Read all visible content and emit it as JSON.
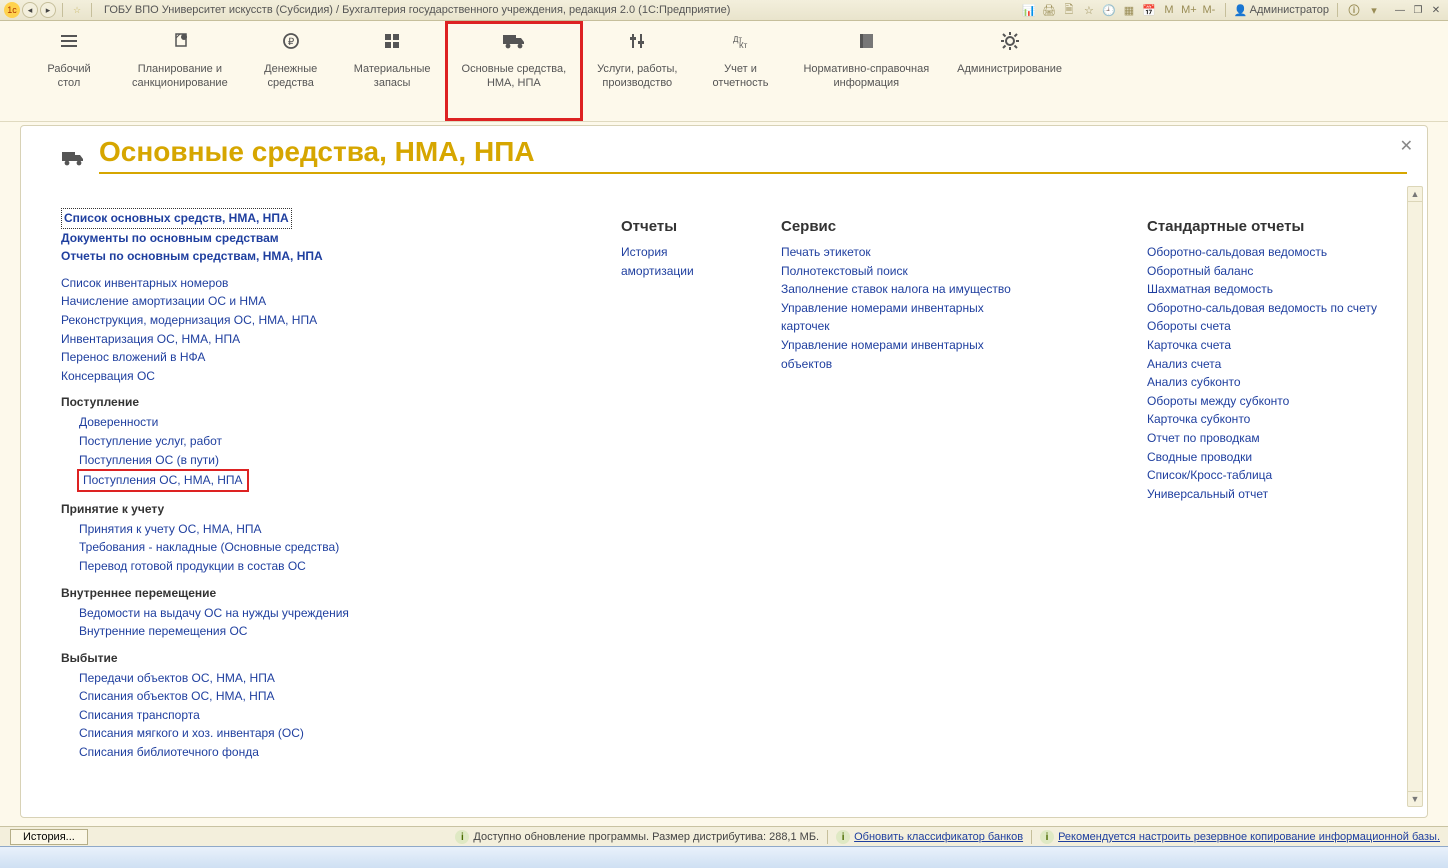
{
  "titlebar": {
    "title": "ГОБУ ВПО Университет искусств (Субсидия) / Бухгалтерия государственного учреждения, редакция 2.0  (1С:Предприятие)",
    "user": "Администратор",
    "m": "M",
    "mp": "M+",
    "mm": "M-"
  },
  "ribbon": [
    {
      "id": "desktop",
      "label": "Рабочий\nстол"
    },
    {
      "id": "planning",
      "label": "Планирование и\nсанкционирование"
    },
    {
      "id": "cash",
      "label": "Денежные\nсредства"
    },
    {
      "id": "stock",
      "label": "Материальные\nзапасы"
    },
    {
      "id": "fixed",
      "label": "Основные средства,\nНМА, НПА",
      "active": true
    },
    {
      "id": "services",
      "label": "Услуги, работы,\nпроизводство"
    },
    {
      "id": "accounting",
      "label": "Учет и\nотчетность"
    },
    {
      "id": "refs",
      "label": "Нормативно-справочная\nинформация"
    },
    {
      "id": "admin",
      "label": "Администрирование"
    }
  ],
  "page": {
    "title": "Основные средства, НМА, НПА"
  },
  "col1": {
    "top": [
      {
        "t": "Список основных средств, НМА, НПА",
        "bold": true,
        "sel": true
      },
      {
        "t": "Документы по основным средствам",
        "bold": true
      },
      {
        "t": "Отчеты по основным средствам, НМА, НПА",
        "bold": true
      }
    ],
    "ops": [
      "Список инвентарных номеров",
      "Начисление амортизации ОС и НМА",
      "Реконструкция, модернизация ОС, НМА, НПА",
      "Инвентаризация ОС, НМА, НПА",
      "Перенос вложений в НФА",
      "Консервация ОС"
    ],
    "g_post": "Поступление",
    "post": [
      "Доверенности",
      "Поступление услуг, работ",
      "Поступления ОС (в пути)"
    ],
    "post_hl": "Поступления ОС, НМА, НПА",
    "g_accept": "Принятие к учету",
    "accept": [
      "Принятия к учету ОС, НМА, НПА",
      "Требования - накладные (Основные средства)",
      "Перевод готовой продукции в состав ОС"
    ],
    "g_move": "Внутреннее перемещение",
    "move": [
      "Ведомости на выдачу ОС на нужды учреждения",
      "Внутренние перемещения ОС"
    ],
    "g_dispose": "Выбытие",
    "dispose": [
      "Передачи объектов ОС, НМА, НПА",
      "Списания объектов ОС, НМА, НПА",
      "Списания транспорта",
      "Списания мягкого и хоз. инвентаря (ОС)",
      "Списания библиотечного фонда"
    ]
  },
  "col2": {
    "h": "Отчеты",
    "items": [
      "История",
      "амортизации"
    ]
  },
  "col3": {
    "h": "Сервис",
    "items": [
      "Печать этикеток",
      "Полнотекстовый поиск",
      "Заполнение ставок налога на имущество",
      "Управление номерами инвентарных карточек",
      "Управление номерами инвентарных объектов"
    ]
  },
  "col4": {
    "h": "Стандартные отчеты",
    "items": [
      "Оборотно-сальдовая ведомость",
      "Оборотный баланс",
      "Шахматная ведомость",
      "Оборотно-сальдовая ведомость по счету",
      "Обороты счета",
      "Карточка счета",
      "Анализ счета",
      "Анализ субконто",
      "Обороты между субконто",
      "Карточка субконто",
      "Отчет по проводкам",
      "Сводные проводки",
      "Список/Кросс-таблица",
      "Универсальный отчет"
    ]
  },
  "footer": {
    "history": "История...",
    "msg1_pre": "Доступно обновление программы. Размер дистрибутива: 288,1 МБ.",
    "msg2": "Обновить классификатор банков",
    "msg3": "Рекомендуется настроить резервное копирование информационной базы."
  }
}
